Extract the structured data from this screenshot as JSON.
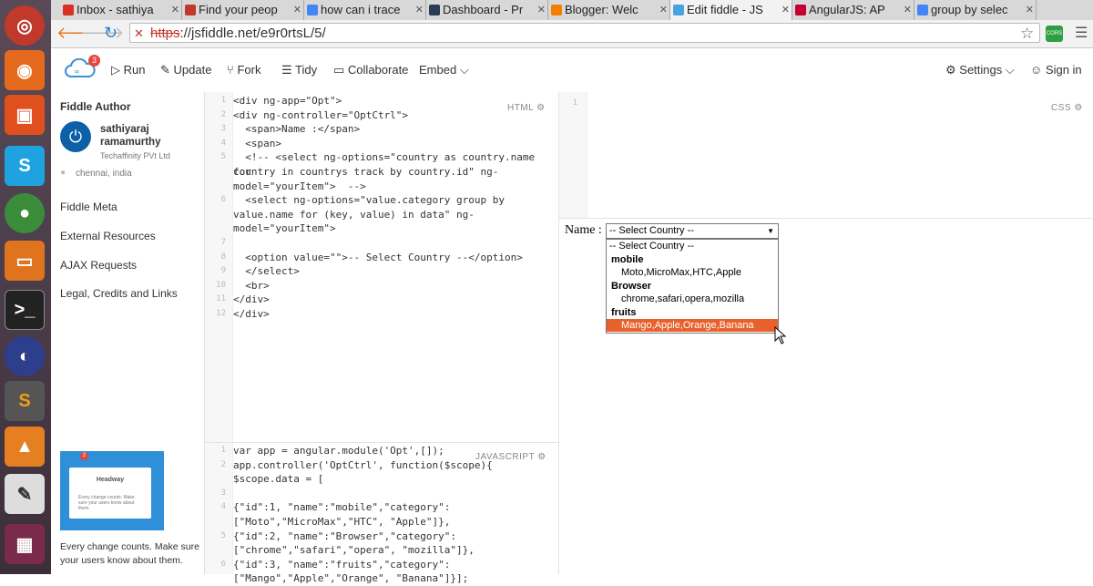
{
  "browser": {
    "tabs": [
      {
        "label": "Inbox - sathiya",
        "color": "#d93025",
        "active": false
      },
      {
        "label": "Find your peop",
        "color": "#c0392b",
        "active": false
      },
      {
        "label": "how can i trace",
        "color": "#4285f4",
        "active": false
      },
      {
        "label": "Dashboard - Pr",
        "color": "#2b3a55",
        "active": false
      },
      {
        "label": "Blogger: Welc",
        "color": "#f57d00",
        "active": false
      },
      {
        "label": "Edit fiddle - JS",
        "color": "#4aa3df",
        "active": true
      },
      {
        "label": "AngularJS: AP",
        "color": "#c3002f",
        "active": false
      },
      {
        "label": "group by selec",
        "color": "#4285f4",
        "active": false
      }
    ],
    "url_scheme": "https",
    "url_rest": "://jsfiddle.net/e9r0rtsL/5/",
    "ext_label": "CORS"
  },
  "header": {
    "badge": "3",
    "run": "Run",
    "update": "Update",
    "fork": "Fork",
    "tidy": "Tidy",
    "collaborate": "Collaborate",
    "embed": "Embed",
    "settings": "Settings",
    "signin": "Sign in"
  },
  "sidebar": {
    "author_heading": "Fiddle Author",
    "author_name_1": "sathiyaraj",
    "author_name_2": "ramamurthy",
    "company": "Techaffinity PVt Ltd",
    "location": "chennai, india",
    "links": [
      "Fiddle Meta",
      "External Resources",
      "AJAX Requests",
      "Legal, Credits and Links"
    ],
    "promo_badge": "2",
    "promo_title": "Headway",
    "promo_card_text": "Every change counts. Make sure your users know about them.",
    "promo_caption_1": "Every change counts. Make sure",
    "promo_caption_2": "your users know about them."
  },
  "html_panel": {
    "label": "HTML",
    "line_numbers": [
      "1",
      "2",
      "3",
      "4",
      "5",
      "",
      "",
      "6",
      "",
      "",
      "7",
      "8",
      "9",
      "10",
      "11",
      "12"
    ],
    "lines": [
      "<div ng-app=\"Opt\">",
      "<div ng-controller=\"OptCtrl\">",
      "  <span>Name :</span>",
      "  <span>",
      "  <!-- <select ng-options=\"country as country.name for",
      "country in countrys track by country.id\" ng-",
      "model=\"yourItem\">  -->",
      "  <select ng-options=\"value.category group by",
      "value.name for (key, value) in data\" ng-",
      "model=\"yourItem\">",
      "",
      "  <option value=\"\">-- Select Country --</option>",
      "  </select>",
      "  <br>",
      "</div>",
      "</div>"
    ]
  },
  "css_panel": {
    "label": "CSS",
    "line_numbers": [
      "1"
    ]
  },
  "js_panel": {
    "label": "JAVASCRIPT",
    "line_numbers": [
      "1",
      "2",
      "",
      "3",
      "4",
      "",
      "5",
      "",
      "6",
      ""
    ],
    "lines": [
      "var app = angular.module('Opt',[]);",
      "app.controller('OptCtrl', function($scope){",
      "$scope.data = [",
      "",
      "{\"id\":1, \"name\":\"mobile\",\"category\":",
      "[\"Moto\",\"MicroMax\",\"HTC\", \"Apple\"]},",
      "{\"id\":2, \"name\":\"Browser\",\"category\":",
      "[\"chrome\",\"safari\",\"opera\", \"mozilla\"]},",
      "{\"id\":3, \"name\":\"fruits\",\"category\":",
      "[\"Mango\",\"Apple\",\"Orange\", \"Banana\"]}];"
    ]
  },
  "result": {
    "name_label": "Name :",
    "select_value": "-- Select Country --",
    "options": [
      {
        "text": "-- Select Country --",
        "kind": "option"
      },
      {
        "text": "mobile",
        "kind": "group"
      },
      {
        "text": "Moto,MicroMax,HTC,Apple",
        "kind": "child"
      },
      {
        "text": "Browser",
        "kind": "group"
      },
      {
        "text": "chrome,safari,opera,mozilla",
        "kind": "child"
      },
      {
        "text": "fruits",
        "kind": "group"
      },
      {
        "text": "Mango,Apple,Orange,Banana",
        "kind": "child-selected"
      }
    ],
    "highlight_color": "#e8612c"
  }
}
